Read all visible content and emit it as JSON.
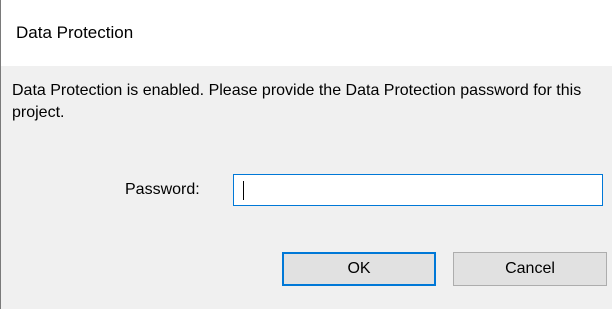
{
  "dialog": {
    "title": "Data Protection",
    "message": "Data Protection is enabled. Please provide the Data Protection password for this project.",
    "password_label": "Password:",
    "password_value": "",
    "ok_label": "OK",
    "cancel_label": "Cancel"
  },
  "colors": {
    "title_background": "#ffffff",
    "body_background": "#f0f0f0",
    "focus_accent": "#0078d7",
    "button_face": "#e1e1e1"
  }
}
